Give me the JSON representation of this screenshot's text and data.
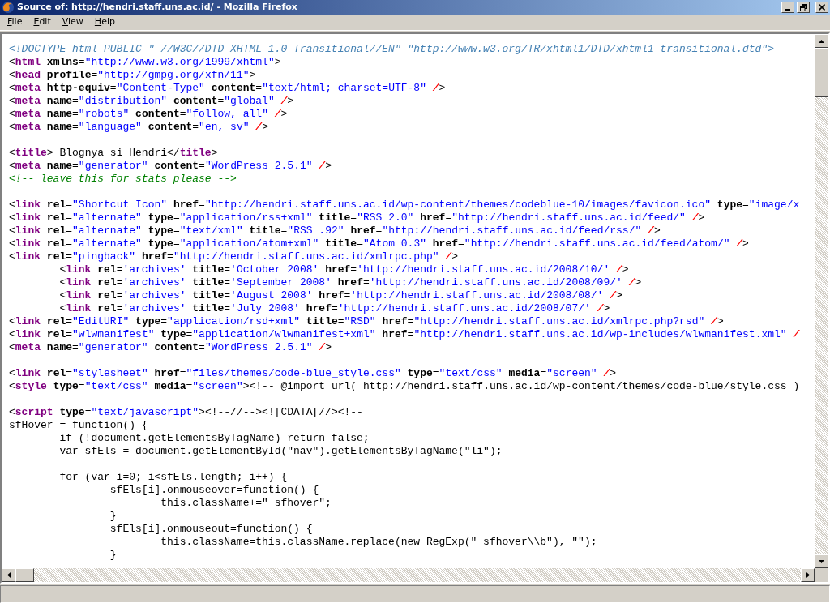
{
  "window": {
    "title": "Source of: http://hendri.staff.uns.ac.id/ - Mozilla Firefox"
  },
  "menu": [
    {
      "label": "File"
    },
    {
      "label": "Edit"
    },
    {
      "label": "View"
    },
    {
      "label": "Help"
    }
  ],
  "source": {
    "blocks": [
      [
        [
          {
            "kind": "doctype",
            "text": "<!DOCTYPE html PUBLIC \"-//W3C//DTD XHTML 1.0 Transitional//EN\" \"http://www.w3.org/TR/xhtml1/DTD/xhtml1-transitional.dtd\">"
          }
        ],
        [
          {
            "kind": "text",
            "text": "<"
          },
          {
            "kind": "tag",
            "text": "html"
          },
          {
            "kind": "attr",
            "text": " xmlns"
          },
          {
            "kind": "text",
            "text": "="
          },
          {
            "kind": "value",
            "text": "\"http://www.w3.org/1999/xhtml\""
          },
          {
            "kind": "text",
            "text": ">"
          }
        ],
        [
          {
            "kind": "text",
            "text": "<"
          },
          {
            "kind": "tag",
            "text": "head"
          },
          {
            "kind": "attr",
            "text": " profile"
          },
          {
            "kind": "text",
            "text": "="
          },
          {
            "kind": "value",
            "text": "\"http://gmpg.org/xfn/11\""
          },
          {
            "kind": "text",
            "text": ">"
          }
        ],
        [
          {
            "kind": "text",
            "text": "<"
          },
          {
            "kind": "tag",
            "text": "meta"
          },
          {
            "kind": "attr",
            "text": " http-equiv"
          },
          {
            "kind": "text",
            "text": "="
          },
          {
            "kind": "value",
            "text": "\"Content-Type\""
          },
          {
            "kind": "attr",
            "text": " content"
          },
          {
            "kind": "text",
            "text": "="
          },
          {
            "kind": "value",
            "text": "\"text/html; charset=UTF-8\""
          },
          {
            "kind": "error",
            "text": " /"
          },
          {
            "kind": "text",
            "text": ">"
          }
        ],
        [
          {
            "kind": "text",
            "text": "<"
          },
          {
            "kind": "tag",
            "text": "meta"
          },
          {
            "kind": "attr",
            "text": " name"
          },
          {
            "kind": "text",
            "text": "="
          },
          {
            "kind": "value",
            "text": "\"distribution\""
          },
          {
            "kind": "attr",
            "text": " content"
          },
          {
            "kind": "text",
            "text": "="
          },
          {
            "kind": "value",
            "text": "\"global\""
          },
          {
            "kind": "error",
            "text": " /"
          },
          {
            "kind": "text",
            "text": ">"
          }
        ],
        [
          {
            "kind": "text",
            "text": "<"
          },
          {
            "kind": "tag",
            "text": "meta"
          },
          {
            "kind": "attr",
            "text": " name"
          },
          {
            "kind": "text",
            "text": "="
          },
          {
            "kind": "value",
            "text": "\"robots\""
          },
          {
            "kind": "attr",
            "text": " content"
          },
          {
            "kind": "text",
            "text": "="
          },
          {
            "kind": "value",
            "text": "\"follow, all\""
          },
          {
            "kind": "error",
            "text": " /"
          },
          {
            "kind": "text",
            "text": ">"
          }
        ],
        [
          {
            "kind": "text",
            "text": "<"
          },
          {
            "kind": "tag",
            "text": "meta"
          },
          {
            "kind": "attr",
            "text": " name"
          },
          {
            "kind": "text",
            "text": "="
          },
          {
            "kind": "value",
            "text": "\"language\""
          },
          {
            "kind": "attr",
            "text": " content"
          },
          {
            "kind": "text",
            "text": "="
          },
          {
            "kind": "value",
            "text": "\"en, sv\""
          },
          {
            "kind": "error",
            "text": " /"
          },
          {
            "kind": "text",
            "text": ">"
          }
        ]
      ],
      [
        [
          {
            "kind": "text",
            "text": "<"
          },
          {
            "kind": "tag",
            "text": "title"
          },
          {
            "kind": "text",
            "text": "> Blognya si Hendri</"
          },
          {
            "kind": "tag",
            "text": "title"
          },
          {
            "kind": "text",
            "text": ">"
          }
        ],
        [
          {
            "kind": "text",
            "text": "<"
          },
          {
            "kind": "tag",
            "text": "meta"
          },
          {
            "kind": "attr",
            "text": " name"
          },
          {
            "kind": "text",
            "text": "="
          },
          {
            "kind": "value",
            "text": "\"generator\""
          },
          {
            "kind": "attr",
            "text": " content"
          },
          {
            "kind": "text",
            "text": "="
          },
          {
            "kind": "value",
            "text": "\"WordPress 2.5.1\""
          },
          {
            "kind": "error",
            "text": " /"
          },
          {
            "kind": "text",
            "text": ">"
          }
        ],
        [
          {
            "kind": "comment",
            "text": "<!-- leave this for stats please -->"
          }
        ]
      ],
      [
        [
          {
            "kind": "text",
            "text": "<"
          },
          {
            "kind": "tag",
            "text": "link"
          },
          {
            "kind": "attr",
            "text": " rel"
          },
          {
            "kind": "text",
            "text": "="
          },
          {
            "kind": "value",
            "text": "\"Shortcut Icon\""
          },
          {
            "kind": "attr",
            "text": " href"
          },
          {
            "kind": "text",
            "text": "="
          },
          {
            "kind": "value",
            "text": "\"http://hendri.staff.uns.ac.id/wp-content/themes/codeblue-10/images/favicon.ico\""
          },
          {
            "kind": "attr",
            "text": " type"
          },
          {
            "kind": "text",
            "text": "="
          },
          {
            "kind": "value",
            "text": "\"image/x"
          }
        ],
        [
          {
            "kind": "text",
            "text": "<"
          },
          {
            "kind": "tag",
            "text": "link"
          },
          {
            "kind": "attr",
            "text": " rel"
          },
          {
            "kind": "text",
            "text": "="
          },
          {
            "kind": "value",
            "text": "\"alternate\""
          },
          {
            "kind": "attr",
            "text": " type"
          },
          {
            "kind": "text",
            "text": "="
          },
          {
            "kind": "value",
            "text": "\"application/rss+xml\""
          },
          {
            "kind": "attr",
            "text": " title"
          },
          {
            "kind": "text",
            "text": "="
          },
          {
            "kind": "value",
            "text": "\"RSS 2.0\""
          },
          {
            "kind": "attr",
            "text": " href"
          },
          {
            "kind": "text",
            "text": "="
          },
          {
            "kind": "value",
            "text": "\"http://hendri.staff.uns.ac.id/feed/\""
          },
          {
            "kind": "error",
            "text": " /"
          },
          {
            "kind": "text",
            "text": ">"
          }
        ],
        [
          {
            "kind": "text",
            "text": "<"
          },
          {
            "kind": "tag",
            "text": "link"
          },
          {
            "kind": "attr",
            "text": " rel"
          },
          {
            "kind": "text",
            "text": "="
          },
          {
            "kind": "value",
            "text": "\"alternate\""
          },
          {
            "kind": "attr",
            "text": " type"
          },
          {
            "kind": "text",
            "text": "="
          },
          {
            "kind": "value",
            "text": "\"text/xml\""
          },
          {
            "kind": "attr",
            "text": " title"
          },
          {
            "kind": "text",
            "text": "="
          },
          {
            "kind": "value",
            "text": "\"RSS .92\""
          },
          {
            "kind": "attr",
            "text": " href"
          },
          {
            "kind": "text",
            "text": "="
          },
          {
            "kind": "value",
            "text": "\"http://hendri.staff.uns.ac.id/feed/rss/\""
          },
          {
            "kind": "error",
            "text": " /"
          },
          {
            "kind": "text",
            "text": ">"
          }
        ],
        [
          {
            "kind": "text",
            "text": "<"
          },
          {
            "kind": "tag",
            "text": "link"
          },
          {
            "kind": "attr",
            "text": " rel"
          },
          {
            "kind": "text",
            "text": "="
          },
          {
            "kind": "value",
            "text": "\"alternate\""
          },
          {
            "kind": "attr",
            "text": " type"
          },
          {
            "kind": "text",
            "text": "="
          },
          {
            "kind": "value",
            "text": "\"application/atom+xml\""
          },
          {
            "kind": "attr",
            "text": " title"
          },
          {
            "kind": "text",
            "text": "="
          },
          {
            "kind": "value",
            "text": "\"Atom 0.3\""
          },
          {
            "kind": "attr",
            "text": " href"
          },
          {
            "kind": "text",
            "text": "="
          },
          {
            "kind": "value",
            "text": "\"http://hendri.staff.uns.ac.id/feed/atom/\""
          },
          {
            "kind": "error",
            "text": " /"
          },
          {
            "kind": "text",
            "text": ">"
          }
        ],
        [
          {
            "kind": "text",
            "text": "<"
          },
          {
            "kind": "tag",
            "text": "link"
          },
          {
            "kind": "attr",
            "text": " rel"
          },
          {
            "kind": "text",
            "text": "="
          },
          {
            "kind": "value",
            "text": "\"pingback\""
          },
          {
            "kind": "attr",
            "text": " href"
          },
          {
            "kind": "text",
            "text": "="
          },
          {
            "kind": "value",
            "text": "\"http://hendri.staff.uns.ac.id/xmlrpc.php\""
          },
          {
            "kind": "error",
            "text": " /"
          },
          {
            "kind": "text",
            "text": ">"
          }
        ],
        [
          {
            "kind": "text",
            "text": "        <"
          },
          {
            "kind": "tag",
            "text": "link"
          },
          {
            "kind": "attr",
            "text": " rel"
          },
          {
            "kind": "text",
            "text": "="
          },
          {
            "kind": "value",
            "text": "'archives'"
          },
          {
            "kind": "attr",
            "text": " title"
          },
          {
            "kind": "text",
            "text": "="
          },
          {
            "kind": "value",
            "text": "'October 2008'"
          },
          {
            "kind": "attr",
            "text": " href"
          },
          {
            "kind": "text",
            "text": "="
          },
          {
            "kind": "value",
            "text": "'http://hendri.staff.uns.ac.id/2008/10/'"
          },
          {
            "kind": "error",
            "text": " /"
          },
          {
            "kind": "text",
            "text": ">"
          }
        ],
        [
          {
            "kind": "text",
            "text": "        <"
          },
          {
            "kind": "tag",
            "text": "link"
          },
          {
            "kind": "attr",
            "text": " rel"
          },
          {
            "kind": "text",
            "text": "="
          },
          {
            "kind": "value",
            "text": "'archives'"
          },
          {
            "kind": "attr",
            "text": " title"
          },
          {
            "kind": "text",
            "text": "="
          },
          {
            "kind": "value",
            "text": "'September 2008'"
          },
          {
            "kind": "attr",
            "text": " href"
          },
          {
            "kind": "text",
            "text": "="
          },
          {
            "kind": "value",
            "text": "'http://hendri.staff.uns.ac.id/2008/09/'"
          },
          {
            "kind": "error",
            "text": " /"
          },
          {
            "kind": "text",
            "text": ">"
          }
        ],
        [
          {
            "kind": "text",
            "text": "        <"
          },
          {
            "kind": "tag",
            "text": "link"
          },
          {
            "kind": "attr",
            "text": " rel"
          },
          {
            "kind": "text",
            "text": "="
          },
          {
            "kind": "value",
            "text": "'archives'"
          },
          {
            "kind": "attr",
            "text": " title"
          },
          {
            "kind": "text",
            "text": "="
          },
          {
            "kind": "value",
            "text": "'August 2008'"
          },
          {
            "kind": "attr",
            "text": " href"
          },
          {
            "kind": "text",
            "text": "="
          },
          {
            "kind": "value",
            "text": "'http://hendri.staff.uns.ac.id/2008/08/'"
          },
          {
            "kind": "error",
            "text": " /"
          },
          {
            "kind": "text",
            "text": ">"
          }
        ],
        [
          {
            "kind": "text",
            "text": "        <"
          },
          {
            "kind": "tag",
            "text": "link"
          },
          {
            "kind": "attr",
            "text": " rel"
          },
          {
            "kind": "text",
            "text": "="
          },
          {
            "kind": "value",
            "text": "'archives'"
          },
          {
            "kind": "attr",
            "text": " title"
          },
          {
            "kind": "text",
            "text": "="
          },
          {
            "kind": "value",
            "text": "'July 2008'"
          },
          {
            "kind": "attr",
            "text": " href"
          },
          {
            "kind": "text",
            "text": "="
          },
          {
            "kind": "value",
            "text": "'http://hendri.staff.uns.ac.id/2008/07/'"
          },
          {
            "kind": "error",
            "text": " /"
          },
          {
            "kind": "text",
            "text": ">"
          }
        ],
        [
          {
            "kind": "text",
            "text": "<"
          },
          {
            "kind": "tag",
            "text": "link"
          },
          {
            "kind": "attr",
            "text": " rel"
          },
          {
            "kind": "text",
            "text": "="
          },
          {
            "kind": "value",
            "text": "\"EditURI\""
          },
          {
            "kind": "attr",
            "text": " type"
          },
          {
            "kind": "text",
            "text": "="
          },
          {
            "kind": "value",
            "text": "\"application/rsd+xml\""
          },
          {
            "kind": "attr",
            "text": " title"
          },
          {
            "kind": "text",
            "text": "="
          },
          {
            "kind": "value",
            "text": "\"RSD\""
          },
          {
            "kind": "attr",
            "text": " href"
          },
          {
            "kind": "text",
            "text": "="
          },
          {
            "kind": "value",
            "text": "\"http://hendri.staff.uns.ac.id/xmlrpc.php?rsd\""
          },
          {
            "kind": "error",
            "text": " /"
          },
          {
            "kind": "text",
            "text": ">"
          }
        ],
        [
          {
            "kind": "text",
            "text": "<"
          },
          {
            "kind": "tag",
            "text": "link"
          },
          {
            "kind": "attr",
            "text": " rel"
          },
          {
            "kind": "text",
            "text": "="
          },
          {
            "kind": "value",
            "text": "\"wlwmanifest\""
          },
          {
            "kind": "attr",
            "text": " type"
          },
          {
            "kind": "text",
            "text": "="
          },
          {
            "kind": "value",
            "text": "\"application/wlwmanifest+xml\""
          },
          {
            "kind": "attr",
            "text": " href"
          },
          {
            "kind": "text",
            "text": "="
          },
          {
            "kind": "value",
            "text": "\"http://hendri.staff.uns.ac.id/wp-includes/wlwmanifest.xml\""
          },
          {
            "kind": "error",
            "text": " /"
          }
        ],
        [
          {
            "kind": "text",
            "text": "<"
          },
          {
            "kind": "tag",
            "text": "meta"
          },
          {
            "kind": "attr",
            "text": " name"
          },
          {
            "kind": "text",
            "text": "="
          },
          {
            "kind": "value",
            "text": "\"generator\""
          },
          {
            "kind": "attr",
            "text": " content"
          },
          {
            "kind": "text",
            "text": "="
          },
          {
            "kind": "value",
            "text": "\"WordPress 2.5.1\""
          },
          {
            "kind": "error",
            "text": " /"
          },
          {
            "kind": "text",
            "text": ">"
          }
        ]
      ],
      [
        [
          {
            "kind": "text",
            "text": "<"
          },
          {
            "kind": "tag",
            "text": "link"
          },
          {
            "kind": "attr",
            "text": " rel"
          },
          {
            "kind": "text",
            "text": "="
          },
          {
            "kind": "value",
            "text": "\"stylesheet\""
          },
          {
            "kind": "attr",
            "text": " href"
          },
          {
            "kind": "text",
            "text": "="
          },
          {
            "kind": "value",
            "text": "\"files/themes/code-blue_style.css\""
          },
          {
            "kind": "attr",
            "text": " type"
          },
          {
            "kind": "text",
            "text": "="
          },
          {
            "kind": "value",
            "text": "\"text/css\""
          },
          {
            "kind": "attr",
            "text": " media"
          },
          {
            "kind": "text",
            "text": "="
          },
          {
            "kind": "value",
            "text": "\"screen\""
          },
          {
            "kind": "error",
            "text": " /"
          },
          {
            "kind": "text",
            "text": ">"
          }
        ],
        [
          {
            "kind": "text",
            "text": "<"
          },
          {
            "kind": "tag",
            "text": "style"
          },
          {
            "kind": "attr",
            "text": " type"
          },
          {
            "kind": "text",
            "text": "="
          },
          {
            "kind": "value",
            "text": "\"text/css\""
          },
          {
            "kind": "attr",
            "text": " media"
          },
          {
            "kind": "text",
            "text": "="
          },
          {
            "kind": "value",
            "text": "\"screen\""
          },
          {
            "kind": "text",
            "text": "><!-- @import url( http://hendri.staff.uns.ac.id/wp-content/themes/code-blue/style.css )"
          }
        ]
      ],
      [
        [
          {
            "kind": "text",
            "text": "<"
          },
          {
            "kind": "tag",
            "text": "script"
          },
          {
            "kind": "attr",
            "text": " type"
          },
          {
            "kind": "text",
            "text": "="
          },
          {
            "kind": "value",
            "text": "\"text/javascript\""
          },
          {
            "kind": "text",
            "text": "><!--//--><![CDATA[//><!--"
          }
        ],
        [
          {
            "kind": "text",
            "text": "sfHover = function() {"
          }
        ],
        [
          {
            "kind": "text",
            "text": "        if (!document.getElementsByTagName) return false;"
          }
        ],
        [
          {
            "kind": "text",
            "text": "        var sfEls = document.getElementById(\"nav\").getElementsByTagName(\"li\");"
          }
        ]
      ],
      [
        [
          {
            "kind": "text",
            "text": "        for (var i=0; i<sfEls.length; i++) {"
          }
        ],
        [
          {
            "kind": "text",
            "text": "                sfEls[i].onmouseover=function() {"
          }
        ],
        [
          {
            "kind": "text",
            "text": "                        this.className+=\" sfhover\";"
          }
        ],
        [
          {
            "kind": "text",
            "text": "                }"
          }
        ],
        [
          {
            "kind": "text",
            "text": "                sfEls[i].onmouseout=function() {"
          }
        ],
        [
          {
            "kind": "text",
            "text": "                        this.className=this.className.replace(new RegExp(\" sfhover\\\\b\"), \"\");"
          }
        ],
        [
          {
            "kind": "text",
            "text": "                }"
          }
        ]
      ]
    ]
  }
}
